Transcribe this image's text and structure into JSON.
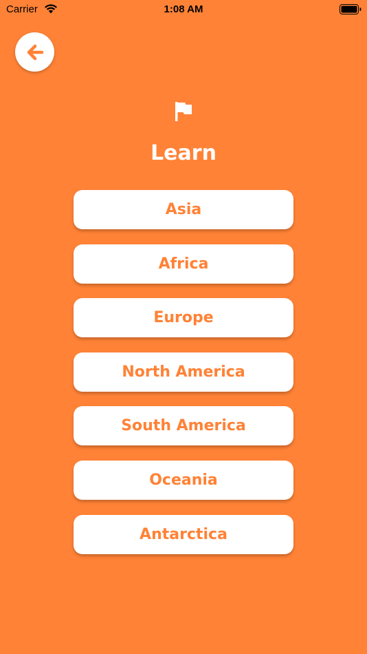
{
  "status_bar": {
    "carrier": "Carrier",
    "time": "1:08 AM",
    "icons": [
      "wifi-icon",
      "battery-icon"
    ]
  },
  "header": {
    "back_icon": "back-arrow-icon",
    "flag_icon": "flag-icon",
    "title": "Learn"
  },
  "continents": [
    {
      "label": "Asia"
    },
    {
      "label": "Africa"
    },
    {
      "label": "Europe"
    },
    {
      "label": "North America"
    },
    {
      "label": "South America"
    },
    {
      "label": "Oceania"
    },
    {
      "label": "Antarctica"
    }
  ],
  "colors": {
    "background": "#FF8236",
    "button_background": "#ffffff",
    "button_text": "#FF8236",
    "title_text": "#ffffff"
  }
}
